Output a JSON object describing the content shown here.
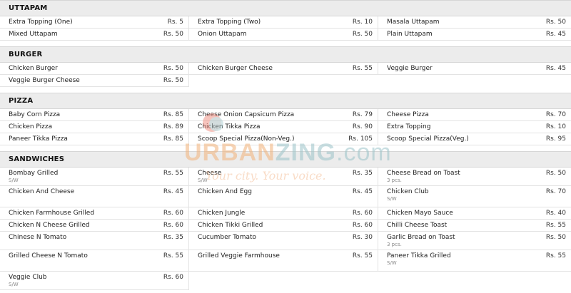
{
  "sections": [
    {
      "title": "UTTAPAM",
      "items": [
        {
          "name": "Extra Topping (One)",
          "price": "Rs. 5",
          "note": ""
        },
        {
          "name": "Extra Topping (Two)",
          "price": "Rs. 10",
          "note": ""
        },
        {
          "name": "Masala Uttapam",
          "price": "Rs. 50",
          "note": ""
        },
        {
          "name": "Mixed Uttapam",
          "price": "Rs. 50",
          "note": ""
        },
        {
          "name": "Onion Uttapam",
          "price": "Rs. 50",
          "note": ""
        },
        {
          "name": "Plain Uttapam",
          "price": "Rs. 45",
          "note": ""
        }
      ]
    },
    {
      "title": "BURGER",
      "items": [
        {
          "name": "Chicken Burger",
          "price": "Rs. 50",
          "note": ""
        },
        {
          "name": "Chicken Burger Cheese",
          "price": "Rs. 55",
          "note": ""
        },
        {
          "name": "Veggie Burger",
          "price": "Rs. 45",
          "note": ""
        },
        {
          "name": "Veggie Burger Cheese",
          "price": "Rs. 50",
          "note": ""
        }
      ]
    },
    {
      "title": "PIZZA",
      "items": [
        {
          "name": "Baby Corn Pizza",
          "price": "Rs. 85",
          "note": ""
        },
        {
          "name": "Cheese Onion Capsicum Pizza",
          "price": "Rs. 79",
          "note": ""
        },
        {
          "name": "Cheese Pizza",
          "price": "Rs. 70",
          "note": ""
        },
        {
          "name": "Chicken Pizza",
          "price": "Rs. 89",
          "note": ""
        },
        {
          "name": "Chicken Tikka Pizza",
          "price": "Rs. 90",
          "note": ""
        },
        {
          "name": "Extra Topping",
          "price": "Rs. 10",
          "note": ""
        },
        {
          "name": "Paneer Tikka Pizza",
          "price": "Rs. 85",
          "note": ""
        },
        {
          "name": "Scoop Special Pizza(Non-Veg.)",
          "price": "Rs. 105",
          "note": ""
        },
        {
          "name": "Scoop Special Pizza(Veg.)",
          "price": "Rs. 95",
          "note": ""
        }
      ]
    },
    {
      "title": "SANDWICHES",
      "items": [
        {
          "name": "Bombay Grilled",
          "price": "Rs. 55",
          "note": "S/W"
        },
        {
          "name": "Cheese",
          "price": "Rs. 35",
          "note": "S/W"
        },
        {
          "name": "Cheese Bread on Toast",
          "price": "Rs. 50",
          "note": "3 pcs."
        },
        {
          "name": "Chicken And Cheese",
          "price": "Rs. 45",
          "note": ""
        },
        {
          "name": "Chicken And Egg",
          "price": "Rs. 45",
          "note": ""
        },
        {
          "name": "Chicken Club",
          "price": "Rs. 70",
          "note": "S/W"
        },
        {
          "name": "Chicken Farmhouse Grilled",
          "price": "Rs. 60",
          "note": ""
        },
        {
          "name": "Chicken Jungle",
          "price": "Rs. 60",
          "note": ""
        },
        {
          "name": "Chicken Mayo Sauce",
          "price": "Rs. 40",
          "note": ""
        },
        {
          "name": "Chicken N Cheese Grilled",
          "price": "Rs. 60",
          "note": ""
        },
        {
          "name": "Chicken Tikki Grilled",
          "price": "Rs. 60",
          "note": ""
        },
        {
          "name": "Chilli Cheese Toast",
          "price": "Rs. 55",
          "note": ""
        },
        {
          "name": "Chinese N Tomato",
          "price": "Rs. 35",
          "note": ""
        },
        {
          "name": "Cucumber Tomato",
          "price": "Rs. 30",
          "note": ""
        },
        {
          "name": "Garlic Bread on Toast",
          "price": "Rs. 50",
          "note": "3 pcs."
        },
        {
          "name": "Grilled Cheese N Tomato",
          "price": "Rs. 55",
          "note": ""
        },
        {
          "name": "Grilled Veggie Farmhouse",
          "price": "Rs. 55",
          "note": ""
        },
        {
          "name": "Paneer Tikka Grilled",
          "price": "Rs. 55",
          "note": "S/W"
        },
        {
          "name": "Veggie Club",
          "price": "Rs. 60",
          "note": "S/W"
        }
      ]
    }
  ],
  "watermark": {
    "brand_part1": "URBAN",
    "brand_part2": "ZING",
    "brand_part3": ".com",
    "tagline": "Your city. Your voice.",
    "pin_icon": "map-pin-icon",
    "colors": {
      "orange": "#f2a567",
      "teal": "#8fbcc2"
    }
  }
}
